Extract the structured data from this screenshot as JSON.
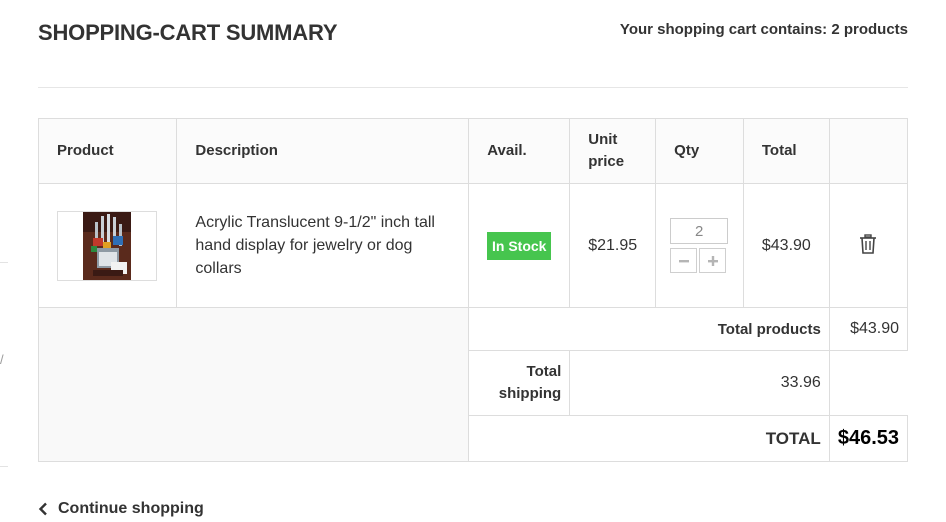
{
  "header": {
    "title": "SHOPPING-CART SUMMARY",
    "cart_count_text": "Your shopping cart contains: 2 products"
  },
  "table": {
    "headers": {
      "product": "Product",
      "description": "Description",
      "avail": "Avail.",
      "unit_price": "Unit price",
      "qty": "Qty",
      "total": "Total"
    },
    "items": [
      {
        "description": "Acrylic Translucent 9-1/2\" inch tall hand display for jewelry or dog collars",
        "availability": "In Stock",
        "unit_price": "$21.95",
        "qty": "2",
        "total": "$43.90"
      }
    ],
    "summary": {
      "total_products_label": "Total products",
      "total_products_value": "$43.90",
      "total_shipping_label": "Total shipping",
      "total_shipping_value": "33.96",
      "total_label": "TOTAL",
      "total_value": "$46.53"
    }
  },
  "footer": {
    "continue_label": "Continue shopping"
  },
  "colors": {
    "in_stock": "#46c54e",
    "border": "#dddddd",
    "text": "#333333"
  },
  "icons": {
    "delete": "trash-icon",
    "back": "chevron-left-icon",
    "decrease": "minus-icon",
    "increase": "plus-icon"
  }
}
